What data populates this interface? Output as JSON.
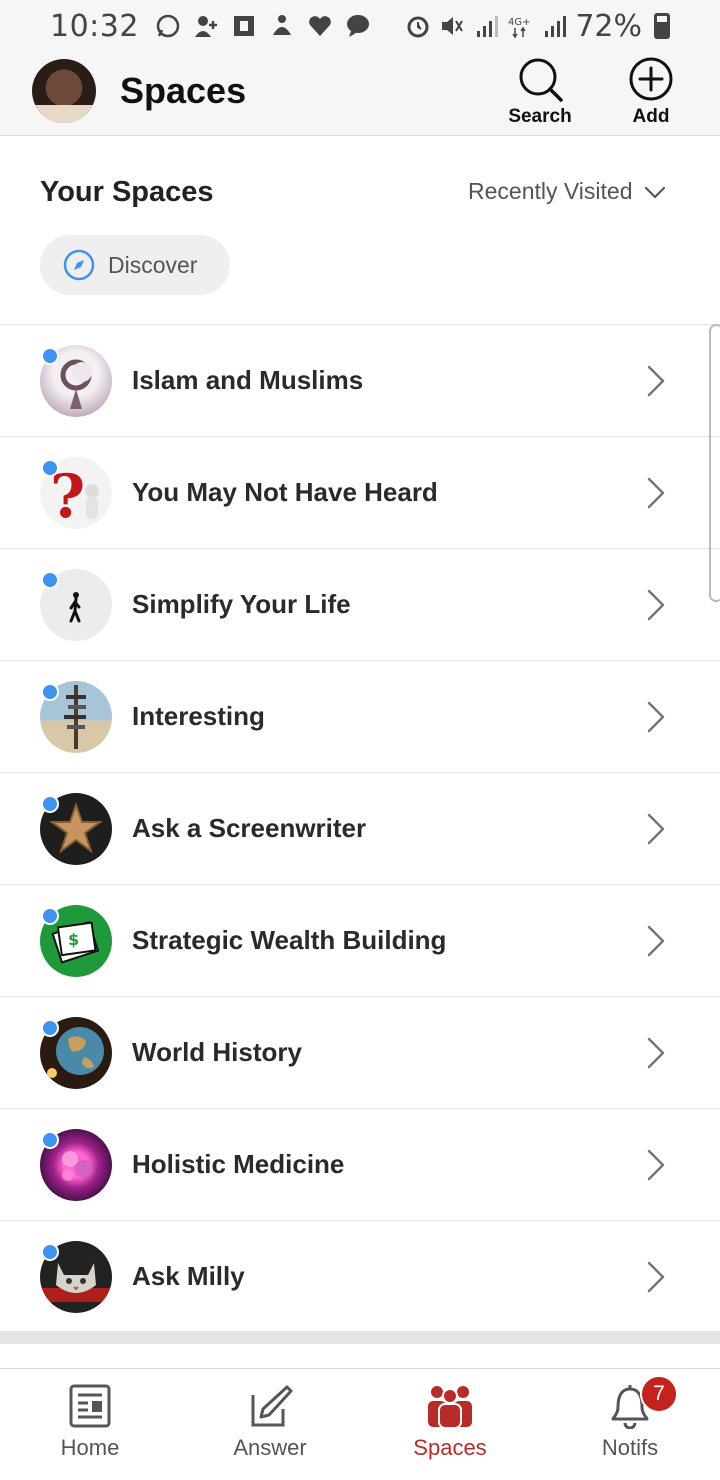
{
  "status_bar": {
    "time": "10:32",
    "battery": "72%"
  },
  "header": {
    "title": "Spaces",
    "search_label": "Search",
    "add_label": "Add"
  },
  "section": {
    "title": "Your Spaces",
    "sort_label": "Recently Visited",
    "discover_label": "Discover"
  },
  "spaces": [
    {
      "name": "Islam and Muslims",
      "icon": "crescent-star-icon"
    },
    {
      "name": "You May Not Have Heard",
      "icon": "question-mark-icon"
    },
    {
      "name": "Simplify Your Life",
      "icon": "walking-person-icon"
    },
    {
      "name": "Interesting",
      "icon": "signpost-icon"
    },
    {
      "name": "Ask a Screenwriter",
      "icon": "star-icon"
    },
    {
      "name": "Strategic Wealth Building",
      "icon": "money-document-icon"
    },
    {
      "name": "World History",
      "icon": "globe-icon"
    },
    {
      "name": "Holistic Medicine",
      "icon": "flower-icon"
    },
    {
      "name": "Ask Milly",
      "icon": "cat-icon"
    }
  ],
  "nav": {
    "home": "Home",
    "answer": "Answer",
    "spaces": "Spaces",
    "notifs": "Notifs",
    "notifs_badge": "7"
  },
  "colors": {
    "accent": "#b92b27",
    "unread": "#3e93f0"
  }
}
